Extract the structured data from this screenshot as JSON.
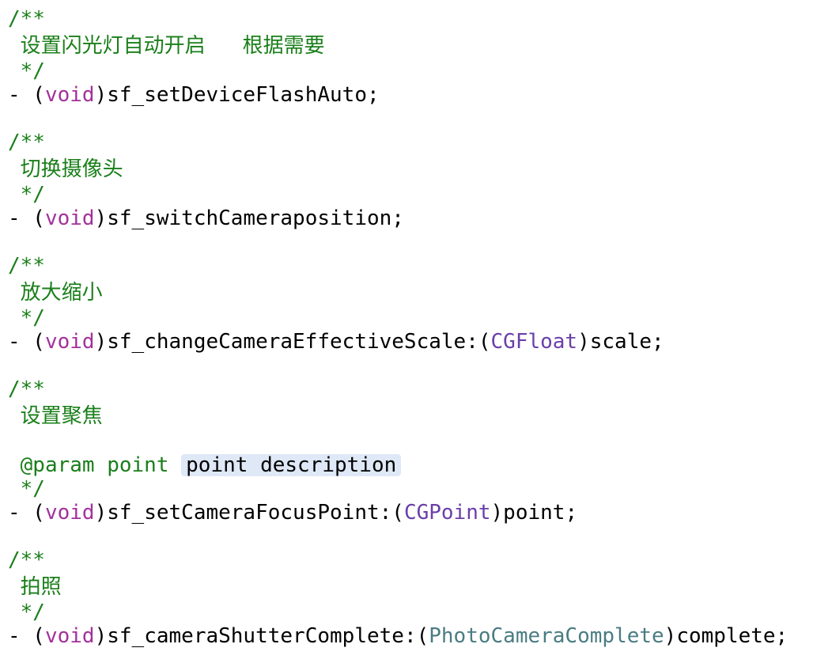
{
  "colors": {
    "comment": "#1a7f1a",
    "keyword": "#a3319b",
    "type": "#6a3fa8",
    "custom_type": "#4a7c82",
    "placeholder_bg": "#dfe8f6"
  },
  "code": {
    "doc_open": "/**",
    "doc_close": " */",
    "dash": "- (",
    "void_kw": "void",
    "close_paren": ")",
    "open_paren": ":(",
    "methods": [
      {
        "comment": " 设置闪光灯自动开启   根据需要",
        "selector": "sf_setDeviceFlashAuto;"
      },
      {
        "comment": " 切换摄像头",
        "selector": "sf_switchCameraposition;"
      },
      {
        "comment": " 放大缩小",
        "selector": "sf_changeCameraEffectiveScale",
        "param_type": "CGFloat",
        "param_name": "scale;"
      },
      {
        "comment": " 设置聚焦",
        "param_doc": " @param point ",
        "placeholder": "point description",
        "selector": "sf_setCameraFocusPoint",
        "param_type": "CGPoint",
        "param_name": "point;"
      },
      {
        "comment": " 拍照",
        "selector": "sf_cameraShutterComplete",
        "param_type": "PhotoCameraComplete",
        "param_name": "complete;"
      }
    ]
  }
}
